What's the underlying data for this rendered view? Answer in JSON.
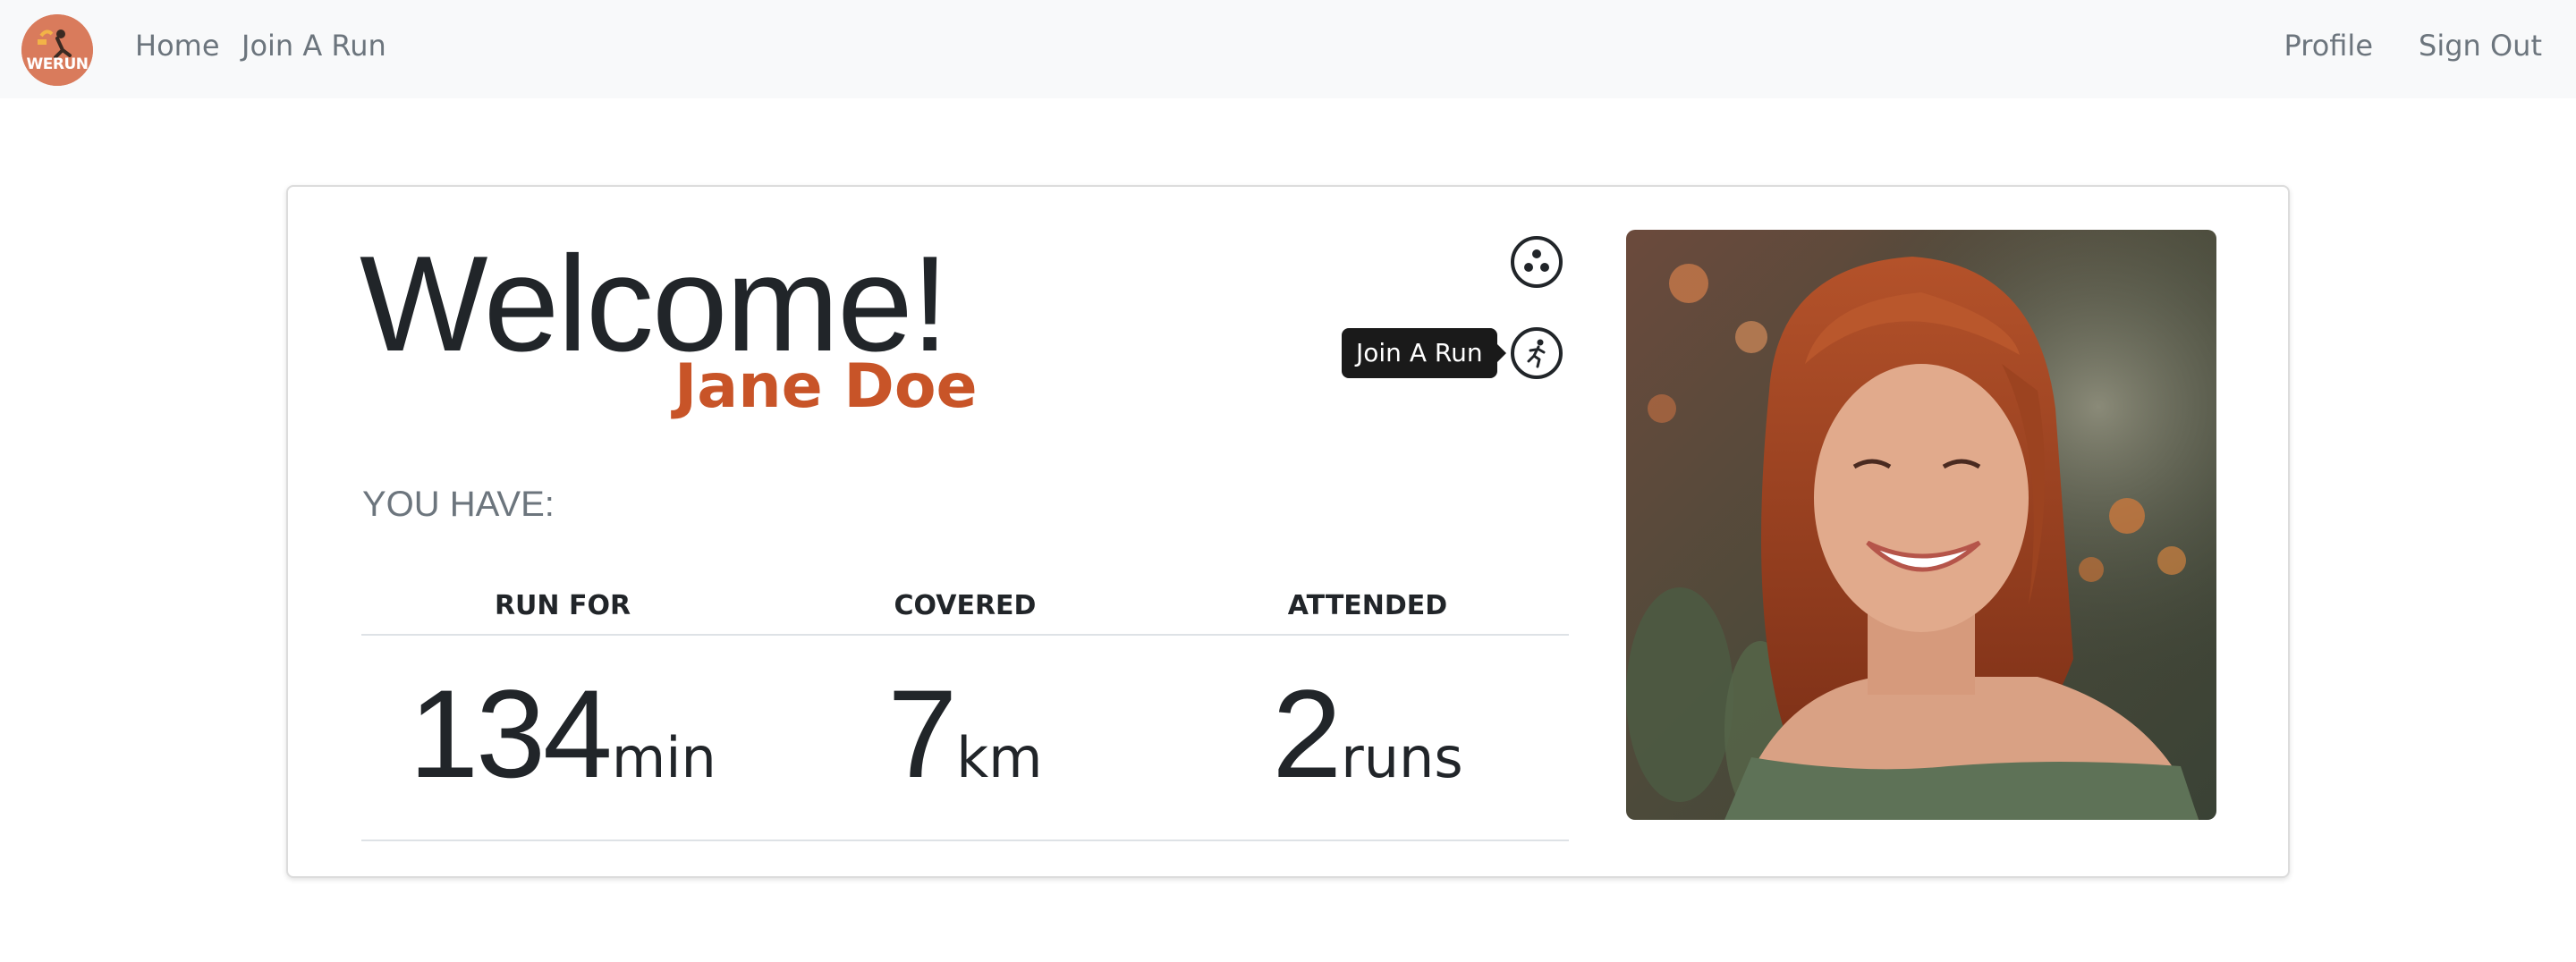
{
  "nav": {
    "logo_text": "WERUN",
    "links": {
      "home": "Home",
      "join": "Join A Run",
      "profile": "Profile",
      "sign_out": "Sign Out"
    }
  },
  "card": {
    "welcome": "Welcome!",
    "user_name": "Jane Doe",
    "you_have": "YOU HAVE:",
    "tooltip": "Join A Run",
    "stats": [
      {
        "label": "RUN FOR",
        "value": "134",
        "unit": "min"
      },
      {
        "label": "COVERED",
        "value": "7",
        "unit": "km"
      },
      {
        "label": "ATTENDED",
        "value": "2",
        "unit": "runs"
      }
    ]
  },
  "icons": {
    "dots": "dots-circle-icon",
    "runner": "runner-icon"
  },
  "colors": {
    "accent": "#c85428",
    "navbar_bg": "#f8f9fa",
    "logo_bg": "#d97b5c",
    "muted_text": "#6c757d",
    "tooltip_bg": "#1a1a1a"
  }
}
